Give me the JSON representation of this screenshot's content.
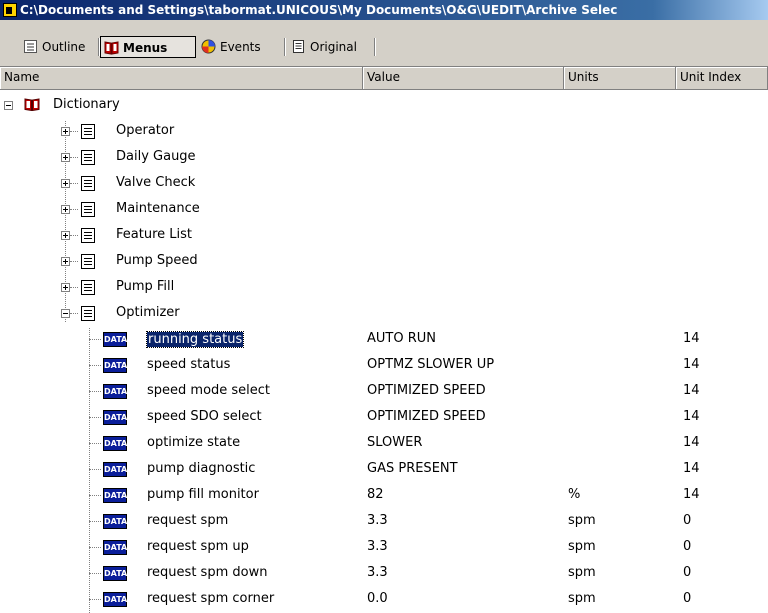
{
  "window": {
    "title": "C:\\Documents and Settings\\tabormat.UNICOUS\\My Documents\\O&G\\UEDIT\\Archive Selec"
  },
  "toolbar": {
    "buttons": [
      {
        "label": "Outline",
        "icon": "outline-icon"
      },
      {
        "label": "Menus",
        "icon": "menus-book-icon",
        "pressed": true
      },
      {
        "label": "Events",
        "icon": "events-icon"
      },
      {
        "label": "Original",
        "icon": "original-doc-icon"
      }
    ]
  },
  "columns": [
    "Name",
    "Value",
    "Units",
    "Unit Index"
  ],
  "tree": {
    "root": {
      "label": "Dictionary",
      "icon": "dictionary-book-icon"
    },
    "groups": [
      {
        "label": "Operator"
      },
      {
        "label": "Daily Gauge"
      },
      {
        "label": "Valve Check"
      },
      {
        "label": "Maintenance"
      },
      {
        "label": "Feature List"
      },
      {
        "label": "Pump Speed"
      },
      {
        "label": "Pump Fill"
      },
      {
        "label": "Optimizer",
        "expanded": true
      }
    ],
    "data_icon_text": "DATA",
    "items": [
      {
        "name": "running status",
        "value": "AUTO RUN",
        "units": "",
        "index": "14",
        "selected": true
      },
      {
        "name": "speed status",
        "value": "OPTMZ SLOWER UP",
        "units": "",
        "index": "14"
      },
      {
        "name": "speed mode select",
        "value": "OPTIMIZED SPEED",
        "units": "",
        "index": "14"
      },
      {
        "name": "speed SDO select",
        "value": "OPTIMIZED SPEED",
        "units": "",
        "index": "14"
      },
      {
        "name": "optimize state",
        "value": "SLOWER",
        "units": "",
        "index": "14"
      },
      {
        "name": "pump diagnostic",
        "value": "GAS PRESENT",
        "units": "",
        "index": "14"
      },
      {
        "name": "pump fill monitor",
        "value": "82",
        "units": "%",
        "index": "14"
      },
      {
        "name": "request spm",
        "value": "3.3",
        "units": "spm",
        "index": "0"
      },
      {
        "name": "request spm up",
        "value": "3.3",
        "units": "spm",
        "index": "0"
      },
      {
        "name": "request spm down",
        "value": "3.3",
        "units": "spm",
        "index": "0"
      },
      {
        "name": "request spm corner",
        "value": "0.0",
        "units": "spm",
        "index": "0"
      }
    ]
  }
}
